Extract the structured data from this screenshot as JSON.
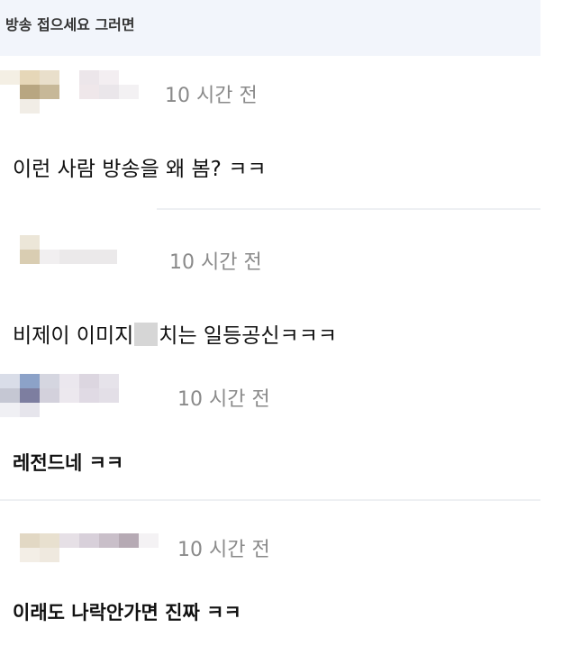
{
  "header": {
    "title": "방송 접으세요 그러면"
  },
  "comments": [
    {
      "time": "10 시간 전",
      "text": "이런 사람 방송을 왜 봄? ㅋㅋ"
    },
    {
      "time": "10 시간 전",
      "text_before": "비제이 이미지",
      "text_after": "치는 일등공신ㅋㅋㅋ"
    },
    {
      "time": "10 시간 전",
      "text": "레전드네 ㅋㅋ"
    },
    {
      "time": "10 시간 전",
      "text": "이래도 나락안가면 진짜 ㅋㅋ"
    }
  ]
}
